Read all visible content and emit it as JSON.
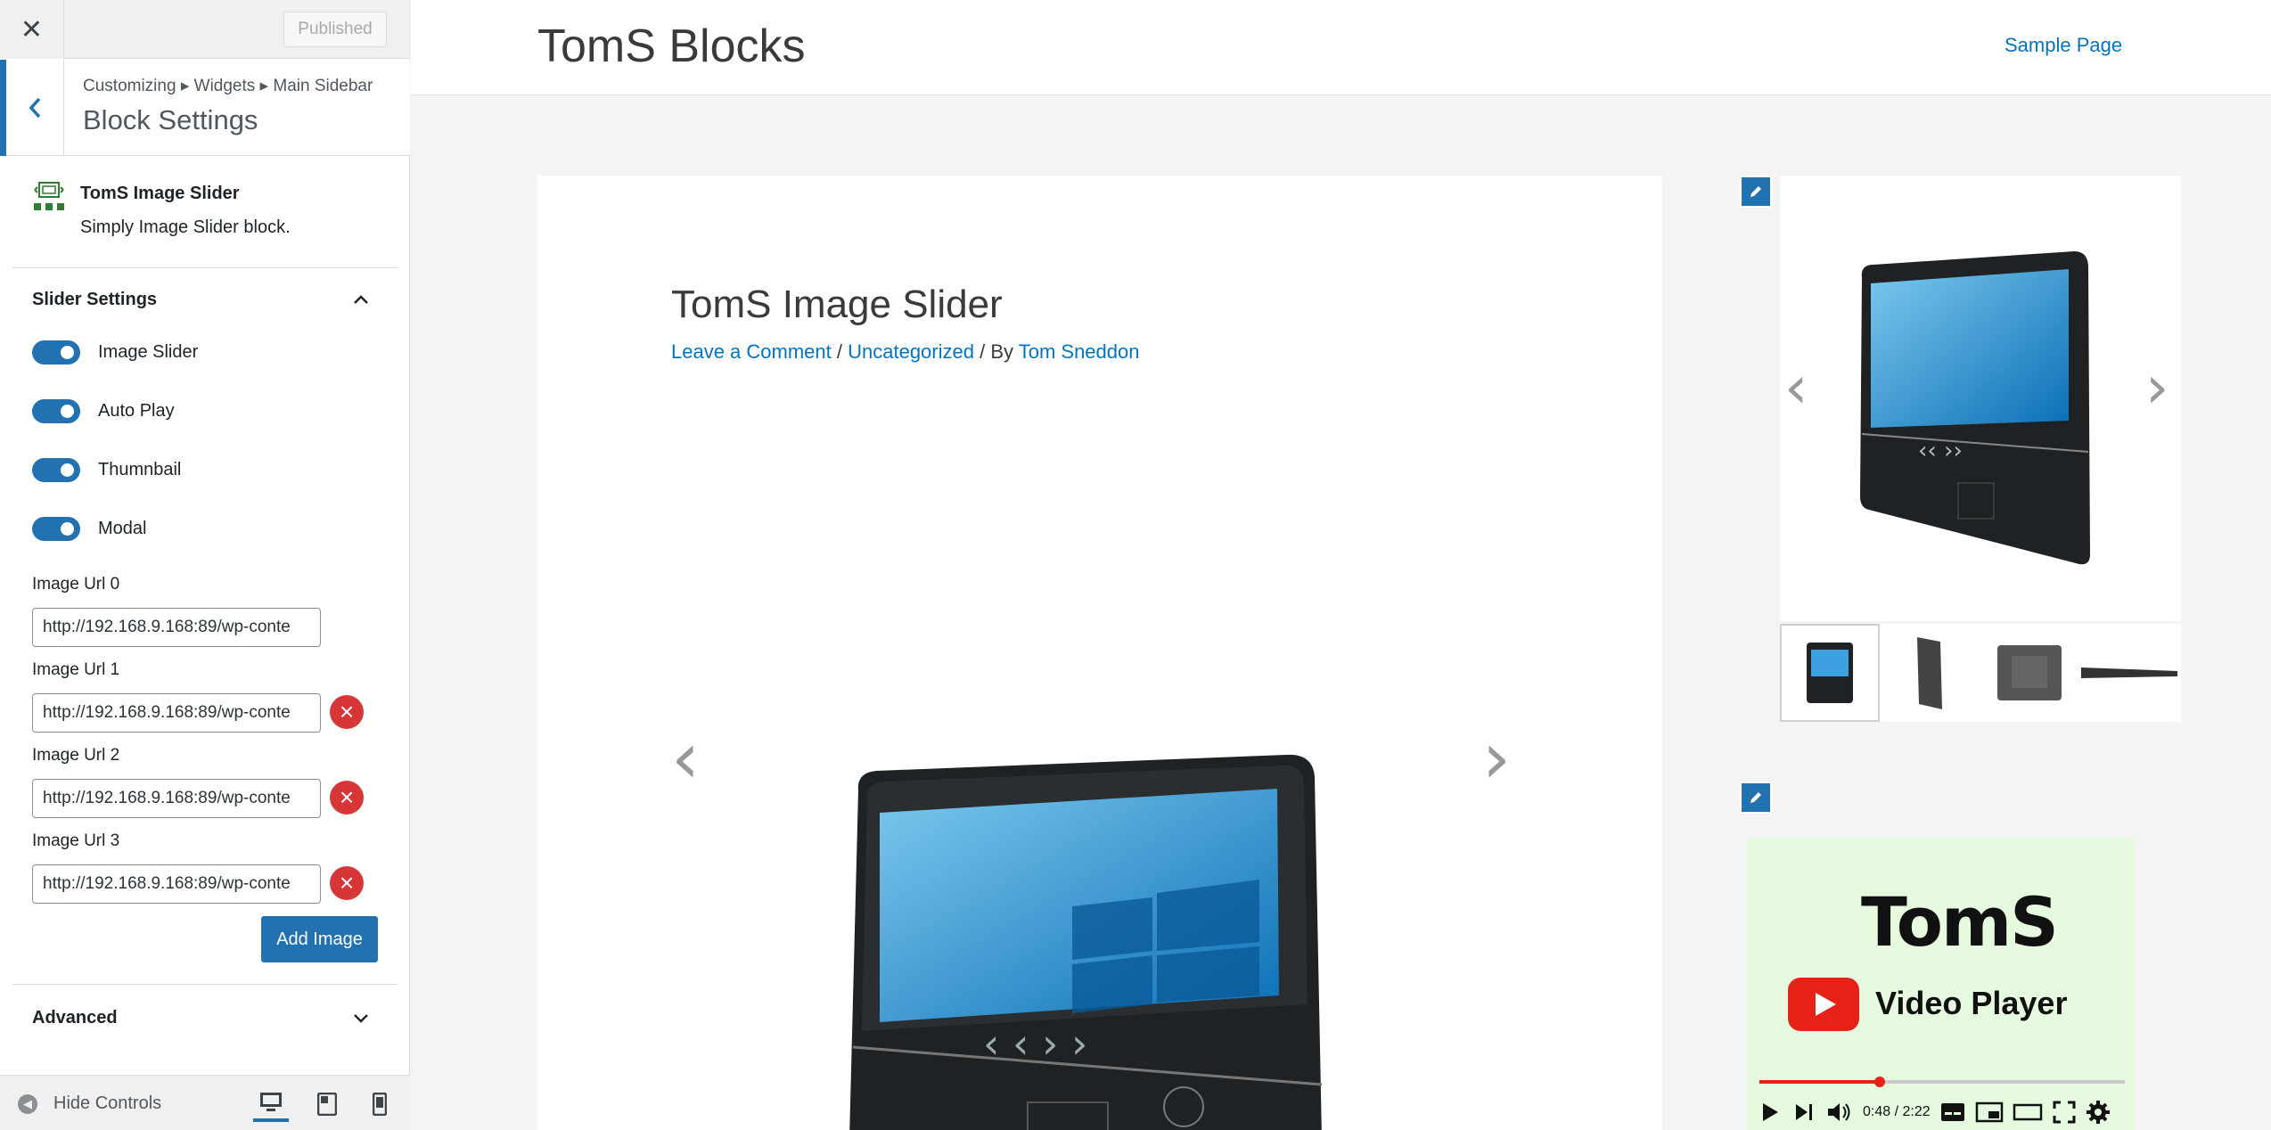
{
  "customizer": {
    "publish_label": "Published",
    "breadcrumb": "Customizing ▸ Widgets ▸ Main Sidebar",
    "section_title": "Block Settings",
    "block": {
      "name": "TomS Image Slider",
      "description": "Simply Image Slider block."
    },
    "panel": {
      "title": "Slider Settings",
      "toggles": [
        {
          "label": "Image Slider",
          "checked": true
        },
        {
          "label": "Auto Play",
          "checked": true
        },
        {
          "label": "Thumnbail",
          "checked": true
        },
        {
          "label": "Modal",
          "checked": true
        }
      ],
      "urls": [
        {
          "label": "Image Url 0",
          "value": "http://192.168.9.168:89/wp-conte"
        },
        {
          "label": "Image Url 1",
          "value": "http://192.168.9.168:89/wp-conte"
        },
        {
          "label": "Image Url 2",
          "value": "http://192.168.9.168:89/wp-conte"
        },
        {
          "label": "Image Url 3",
          "value": "http://192.168.9.168:89/wp-conte"
        }
      ],
      "add_image_label": "Add Image"
    },
    "advanced_label": "Advanced",
    "hide_controls_label": "Hide Controls",
    "accent": "#2271b1",
    "remove_color": "#d63638"
  },
  "preview": {
    "site_title": "TomS Blocks",
    "nav": [
      "Sample Page"
    ],
    "post": {
      "title": "TomS Image Slider",
      "meta_comment": "Leave a Comment",
      "meta_sep1": " / ",
      "meta_category": "Uncategorized",
      "meta_by": " / By ",
      "meta_author": "Tom Sneddon"
    },
    "video": {
      "logo_text": "TomS",
      "title": "Video Player",
      "time": "0:48 / 2:22",
      "progress": 0.33
    },
    "link_color": "#0274be"
  }
}
